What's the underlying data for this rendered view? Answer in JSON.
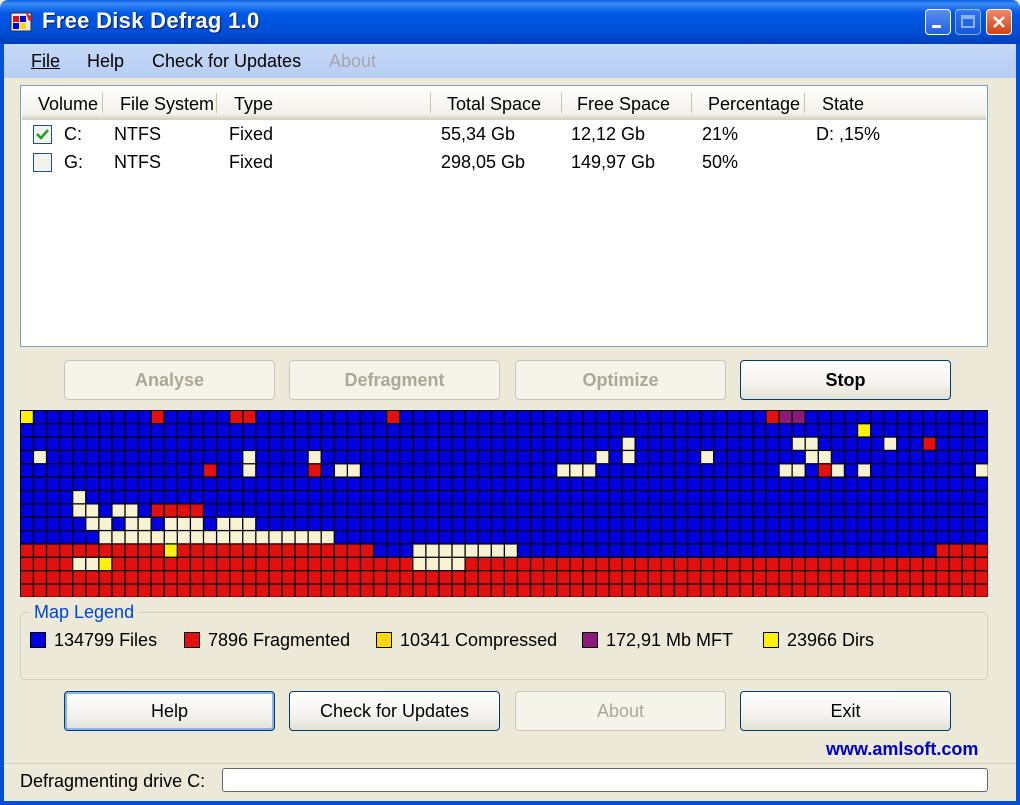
{
  "window": {
    "title": "Free Disk Defrag 1.0"
  },
  "menu": {
    "file": "File",
    "help": "Help",
    "check_updates": "Check for Updates",
    "about": "About"
  },
  "volumes": {
    "columns": [
      "Volume",
      "File System",
      "Type",
      "Total Space",
      "Free Space",
      "Percentage",
      "State"
    ],
    "rows": [
      {
        "checked": true,
        "volume": "C:",
        "fs": "NTFS",
        "type": "Fixed",
        "total": "55,34 Gb",
        "free": "12,12 Gb",
        "pct": "21%",
        "state": "D: ,15%"
      },
      {
        "checked": false,
        "volume": "G:",
        "fs": "NTFS",
        "type": "Fixed",
        "total": "298,05 Gb",
        "free": "149,97 Gb",
        "pct": "50%",
        "state": ""
      }
    ]
  },
  "actions": {
    "analyse": "Analyse",
    "defragment": "Defragment",
    "optimize": "Optimize",
    "stop": "Stop"
  },
  "disk_map": {
    "columns": 74,
    "rows": 14,
    "palette": {
      "B": "#0000E0",
      "R": "#E31010",
      "W": "#F7F2D2",
      "Y": "#FFF200",
      "M": "#8A1A7A"
    },
    "grid": [
      "YBBBBBBBBBRBBBBBRRBBBBBBBBBBRBBBBBBBBBBBBBBBBBBBBBBBBBBBBRMMBBBBBBBBBBBBBB",
      "BBBBBBBBBBBBBBBBBBBBBBBBBBBBBBBBBBBBBBBBBBBBBBBBBBBBBBBBBBBBBBBBYBBBBBBBBB",
      "BBBBBBBBBBBBBBBBBBBBBBBBBBBBBBBBBBBBBBBBBBBBBBWBBBBBBBBBBBBWWBBBBBWBBRBBBB",
      "BWBBBBBBBBBBBBBBBWBBBBWBBBBBBBBBBBBBBBBBBBBBWBWBBBBBWBBBBBBBWWBBBBBBBBBBBB",
      "BBBBBBBBBBBBBBRBBWBBBBRBWWBBBBBBBBBBBBBBBWWWBBBBBBBBBBBBBBWWBRWBWBBBBBBBBW",
      "BBBBBBBBBBBBBBBBBBBBBBBBBBBBBBBBBBBBBBBBBBBBBBBBBBBBBBBBBBBBBBBBBBBBBBBBBB",
      "BBBBWBBBBBBBBBBBBBBBBBBBBBBBBBBBBBBBBBBBBBBBBBBBBBBBBBBBBBBBBBBBBBBBBBBBBB",
      "BBBBWWBWWBRRRRBBBBBBBBBBBBBBBBBBBBBBBBBBBBBBBBBBBBBBBBBBBBBBBBBBBBBBBBBBBB",
      "BBBBBWWBWWBWWWBWWWBBBBBBBBBBBBBBBBBBBBBBBBBBBBBBBBBBBBBBBBBBBBBBBBBBBBBBBB",
      "BBBBBBWWWWWWWWWWWWWWWWWWBBBBBBBBBBBBBBBBBBBBBBBBBBBBBBBBBBBBBBBBBBBBBBBBBB",
      "RRRRRRRRRRRYRRRRRRRRRRRRRRRBBBWWWWWWWWBBBBBBBBBBBBBBBBBBBBBBBBBBBBBBBBRRRR",
      "RRRRWWYRRRRRRRRRRRRRRRRRRRRRRRWWWWRRRRRRRRRRRRRRRRRRRRRRRRRRRRRRRRRRRRRRRR",
      "RRRRRRRRRRRRRRRRRRRRRRRRRRRRRRRRRRRRRRRRRRRRRRRRRRRRRRRRRRRRRRRRRRRRRRRRRR",
      "RRRRRRRRRRRRRRRRRRRRRRRRRRRRRRRRRRRRRRRRRRRRRRRRRRRRRRRRRRRRRRRRRRRRRRRRRR"
    ]
  },
  "legend": {
    "title": "Map Legend",
    "items": [
      {
        "label": "134799 Files",
        "color": "#0000E0"
      },
      {
        "label": "7896 Fragmented",
        "color": "#E31010"
      },
      {
        "label": "10341 Compressed",
        "color": "#FFD700"
      },
      {
        "label": "172,91 Mb MFT",
        "color": "#8A1A7A"
      },
      {
        "label": "23966 Dirs",
        "color": "#FFF200"
      }
    ]
  },
  "bottom_buttons": {
    "help": "Help",
    "check_updates": "Check for Updates",
    "about": "About",
    "exit": "Exit"
  },
  "link": "www.amlsoft.com",
  "status": {
    "text": "Defragmenting drive C:",
    "progress": 0.0
  }
}
